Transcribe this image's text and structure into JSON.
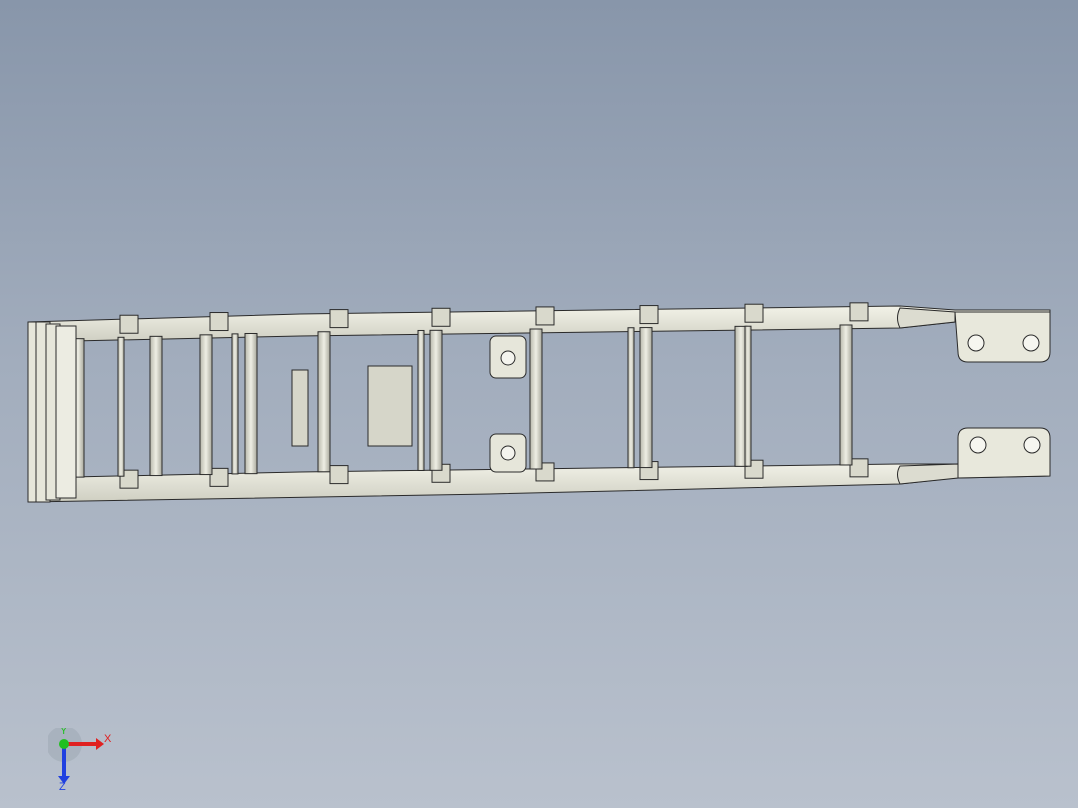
{
  "viewport": {
    "background_top": "#8896aa",
    "background_bottom": "#b9c1cd"
  },
  "model": {
    "part_color": "#e6e6da",
    "part_shade": "#c9c9bb",
    "edge_color": "#2a2a2a",
    "cutout_color": "#5a5a52"
  },
  "triad": {
    "x_label": "X",
    "y_label": "Y",
    "z_label": "Z",
    "x_color": "#e02020",
    "y_color": "#20c020",
    "z_color": "#2040e0"
  }
}
